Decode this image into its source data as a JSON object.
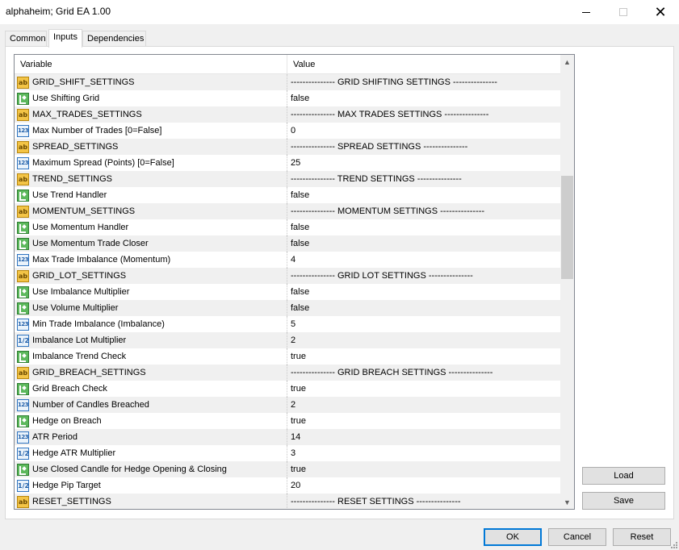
{
  "window": {
    "title": "alphaheim; Grid EA 1.00",
    "controls": [
      "minimize-icon",
      "maximize-icon",
      "close-icon"
    ]
  },
  "tabs": [
    {
      "label": "Common",
      "active": false
    },
    {
      "label": "Inputs",
      "active": true
    },
    {
      "label": "Dependencies",
      "active": false
    }
  ],
  "grid": {
    "headers": {
      "variable": "Variable",
      "value": "Value"
    },
    "rows": [
      {
        "icon": "ab",
        "variable": "GRID_SHIFT_SETTINGS",
        "value": "--------------- GRID SHIFTING SETTINGS ---------------"
      },
      {
        "icon": "bool",
        "variable": "Use Shifting Grid",
        "value": "false"
      },
      {
        "icon": "ab",
        "variable": "MAX_TRADES_SETTINGS",
        "value": "--------------- MAX TRADES SETTINGS ---------------"
      },
      {
        "icon": "int",
        "variable": "Max Number of Trades [0=False]",
        "value": "0"
      },
      {
        "icon": "ab",
        "variable": "SPREAD_SETTINGS",
        "value": "--------------- SPREAD SETTINGS ---------------"
      },
      {
        "icon": "int",
        "variable": "Maximum Spread (Points) [0=False]",
        "value": "25"
      },
      {
        "icon": "ab",
        "variable": "TREND_SETTINGS",
        "value": "--------------- TREND SETTINGS ---------------"
      },
      {
        "icon": "bool",
        "variable": "Use Trend Handler",
        "value": "false"
      },
      {
        "icon": "ab",
        "variable": "MOMENTUM_SETTINGS",
        "value": "--------------- MOMENTUM SETTINGS ---------------"
      },
      {
        "icon": "bool",
        "variable": "Use Momentum Handler",
        "value": "false"
      },
      {
        "icon": "bool",
        "variable": "Use Momentum Trade Closer",
        "value": "false"
      },
      {
        "icon": "int",
        "variable": "Max Trade Imbalance (Momentum)",
        "value": "4"
      },
      {
        "icon": "ab",
        "variable": "GRID_LOT_SETTINGS",
        "value": "--------------- GRID LOT SETTINGS ---------------"
      },
      {
        "icon": "bool",
        "variable": "Use Imbalance Multiplier",
        "value": "false"
      },
      {
        "icon": "bool",
        "variable": "Use Volume Multiplier",
        "value": "false"
      },
      {
        "icon": "int",
        "variable": "Min Trade Imbalance (Imbalance)",
        "value": "5"
      },
      {
        "icon": "dbl",
        "variable": "Imbalance Lot Multiplier",
        "value": "2"
      },
      {
        "icon": "bool",
        "variable": "Imbalance Trend Check",
        "value": "true"
      },
      {
        "icon": "ab",
        "variable": "GRID_BREACH_SETTINGS",
        "value": "--------------- GRID BREACH SETTINGS ---------------"
      },
      {
        "icon": "bool",
        "variable": "Grid Breach Check",
        "value": "true"
      },
      {
        "icon": "int",
        "variable": "Number of Candles Breached",
        "value": "2"
      },
      {
        "icon": "bool",
        "variable": "Hedge on Breach",
        "value": "true"
      },
      {
        "icon": "int",
        "variable": "ATR Period",
        "value": "14"
      },
      {
        "icon": "dbl",
        "variable": "Hedge ATR Multiplier",
        "value": "3"
      },
      {
        "icon": "bool",
        "variable": "Use Closed Candle for Hedge Opening & Closing",
        "value": "true"
      },
      {
        "icon": "dbl",
        "variable": "Hedge Pip Target",
        "value": "20"
      },
      {
        "icon": "ab",
        "variable": "RESET_SETTINGS",
        "value": "--------------- RESET SETTINGS ---------------"
      }
    ],
    "icon_text": {
      "ab": "ab",
      "int": "123",
      "dbl": "1/2",
      "bool": ""
    }
  },
  "buttons": {
    "load": "Load",
    "save": "Save",
    "ok": "OK",
    "cancel": "Cancel",
    "reset": "Reset"
  },
  "colors": {
    "accent": "#0078d7",
    "row_alt": "#f0f0f0"
  }
}
